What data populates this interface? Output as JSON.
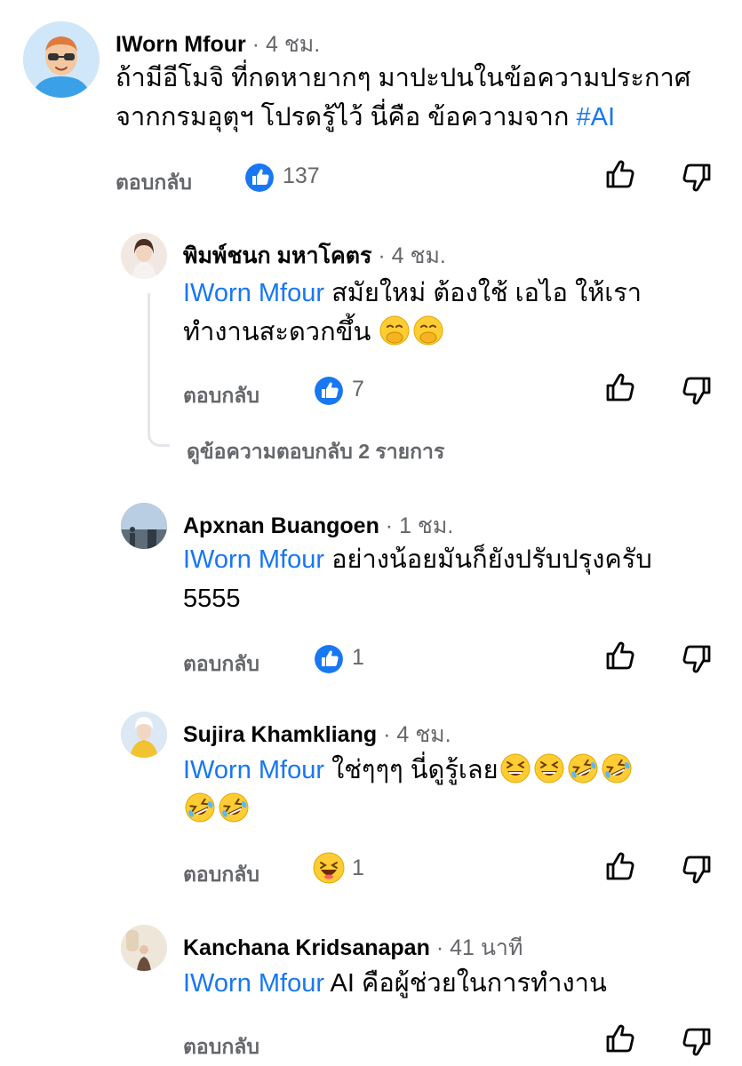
{
  "comments": [
    {
      "name": "IWorn Mfour",
      "time": "4 ชม.",
      "line1": "ถ้ามีอีโมจิ ที่กดหายากๆ มาปะปนในข้อความประกาศ",
      "line2_text": "จากกรมอุตุฯ  โปรดรู้ไว้ นี่คือ ข้อความจาก ",
      "line2_hashtag": "#AI",
      "reply_label": "ตอบกลับ",
      "reaction_count": "137",
      "reaction_icon": "like-reaction-icon"
    },
    {
      "name": "พิมพ์ชนก มหาโคตร",
      "time": "4 ชม.",
      "mention": "IWorn Mfour",
      "line1_text": "  สมัยใหม่ ต้องใช้ เอไอ ให้เรา",
      "line2_text": "ทำงานสะดวกขึ้น ",
      "reply_label": "ตอบกลับ",
      "reaction_count": "7",
      "reaction_icon": "like-reaction-icon",
      "view_replies": "ดูข้อความตอบกลับ 2 รายการ"
    },
    {
      "name": "Apxnan Buangoen",
      "time": "1 ชม.",
      "mention": "IWorn Mfour",
      "line1_text": " อย่างน้อยมันก็ยังปรับปรุงครับ",
      "line2_text": "5555",
      "reply_label": "ตอบกลับ",
      "reaction_count": "1",
      "reaction_icon": "like-reaction-icon"
    },
    {
      "name": "Sujira Khamkliang",
      "time": "4 ชม.",
      "mention": "IWorn Mfour",
      "line1_text": " ใช่ๆๆๆ นี่ดูรู้เลย",
      "reply_label": "ตอบกลับ",
      "reaction_count": "1",
      "reaction_icon": "haha-reaction-icon"
    },
    {
      "name": "Kanchana Kridsanapan",
      "time": "41 นาที",
      "mention": "IWorn Mfour",
      "line1_text": " AI คือผู้ช่วยในการทำงาน",
      "reply_label": "ตอบกลับ"
    }
  ],
  "colors": {
    "accent": "#1877f2",
    "secondary_text": "#65676b",
    "thread_line": "#e4e6eb"
  }
}
